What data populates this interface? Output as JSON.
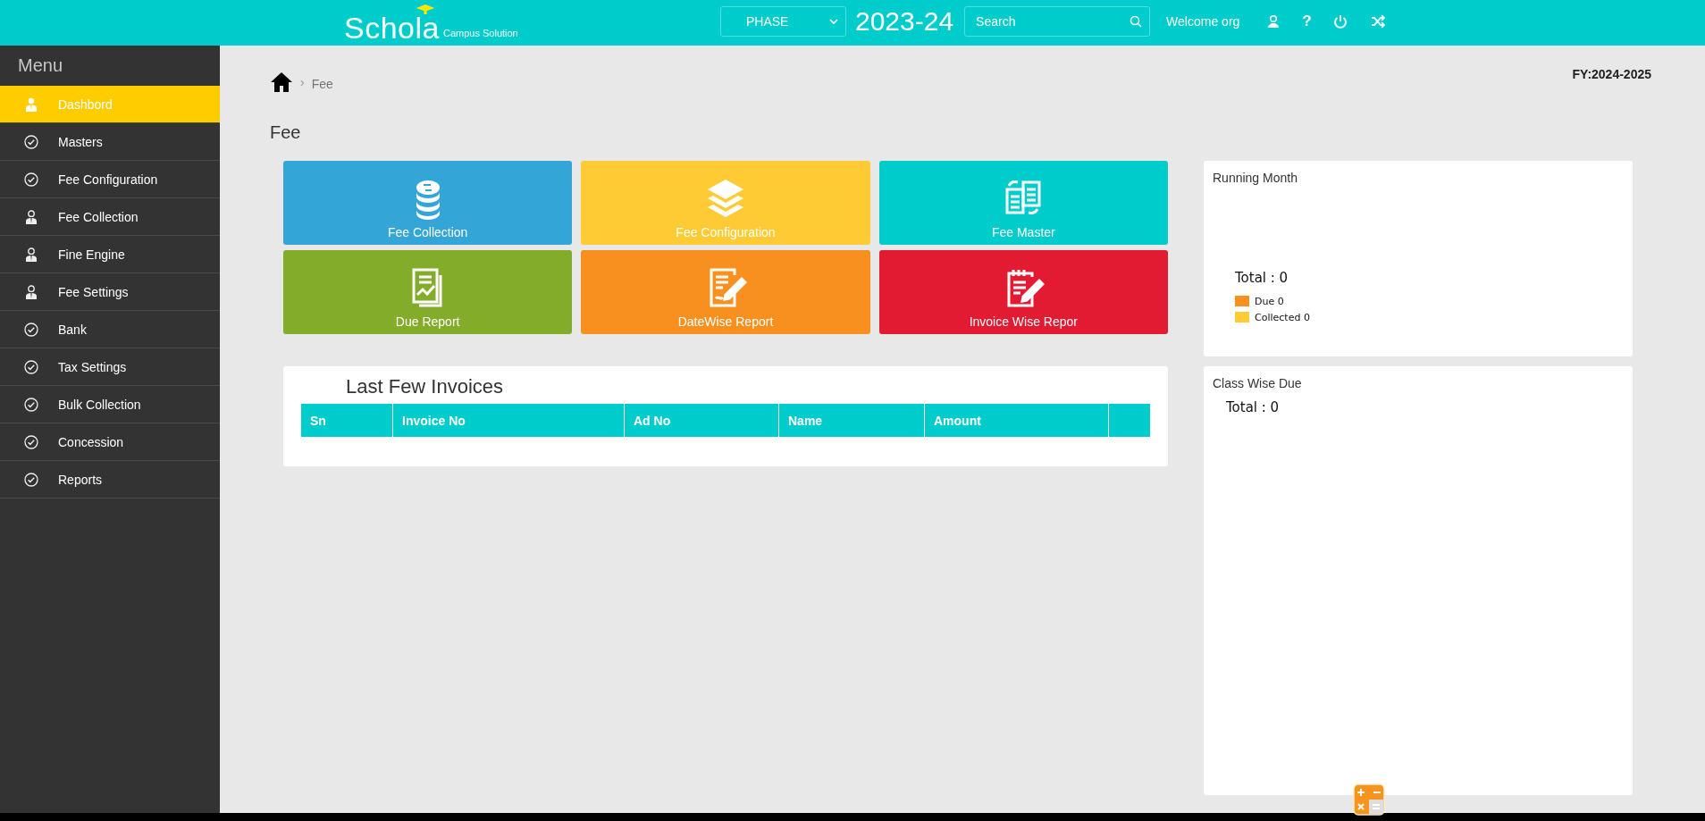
{
  "header": {
    "logo": "Schola",
    "tagline": "Campus Solution",
    "phase_select": {
      "value": "PHASE"
    },
    "year": "2023-24",
    "search": {
      "placeholder": "Search"
    },
    "welcome": "Welcome org",
    "help": "?"
  },
  "sidebar": {
    "title": "Menu",
    "items": [
      {
        "label": "Dashbord",
        "kind": "person",
        "selected": true
      },
      {
        "label": "Masters",
        "kind": "check",
        "selected": false
      },
      {
        "label": "Fee Configuration",
        "kind": "check",
        "selected": false
      },
      {
        "label": "Fee Collection",
        "kind": "user",
        "selected": false
      },
      {
        "label": "Fine Engine",
        "kind": "user",
        "selected": false
      },
      {
        "label": "Fee Settings",
        "kind": "user",
        "selected": false
      },
      {
        "label": "Bank",
        "kind": "check",
        "selected": false
      },
      {
        "label": "Tax Settings",
        "kind": "check",
        "selected": false
      },
      {
        "label": "Bulk Collection",
        "kind": "check",
        "selected": false
      },
      {
        "label": "Concession",
        "kind": "check",
        "selected": false
      },
      {
        "label": "Reports",
        "kind": "check",
        "selected": false
      }
    ]
  },
  "breadcrumb": {
    "separator": "›",
    "current": "Fee"
  },
  "fiscal_year": "FY:2024-2025",
  "page_title": "Fee",
  "tiles": [
    {
      "label": "Fee Collection",
      "color": "#34a5d7"
    },
    {
      "label": "Fee Configuration",
      "color": "#ffcb34"
    },
    {
      "label": "Fee Master",
      "color": "#00cccc"
    },
    {
      "label": "Due Report",
      "color": "#82ac2a"
    },
    {
      "label": "DateWise Report",
      "color": "#f7901f"
    },
    {
      "label": "Invoice Wise Repor",
      "color": "#e21a32"
    }
  ],
  "invoices": {
    "title": "Last Few Invoices",
    "columns": [
      "Sn",
      "Invoice No",
      "Ad No",
      "Name",
      "Amount"
    ]
  },
  "running_month": {
    "title": "Running Month",
    "total": "Total : 0",
    "legend": [
      {
        "label": "Due 0",
        "color": "#f7901f"
      },
      {
        "label": "Collected 0",
        "color": "#ffcb34"
      }
    ]
  },
  "class_wise_due": {
    "title": "Class Wise Due",
    "total": "Total : 0"
  }
}
